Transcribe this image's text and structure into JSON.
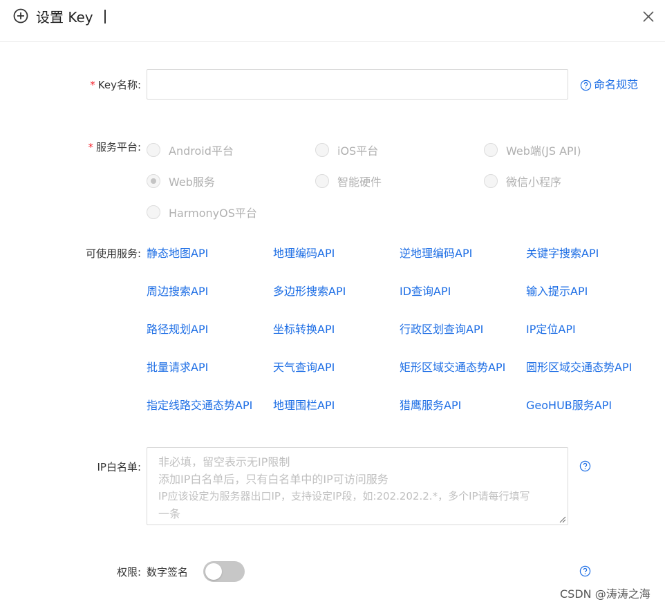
{
  "dialog": {
    "title": "设置 Key"
  },
  "form": {
    "key_name": {
      "required_mark": "*",
      "label": "Key名称:",
      "value": "",
      "help": "命名规范"
    },
    "platform": {
      "required_mark": "*",
      "label": "服务平台:",
      "options": [
        "Android平台",
        "iOS平台",
        "Web端(JS API)",
        "Web服务",
        "智能硬件",
        "微信小程序",
        "HarmonyOS平台"
      ],
      "selected": "Web服务"
    },
    "services": {
      "label": "可使用服务:",
      "items": [
        "静态地图API",
        "地理编码API",
        "逆地理编码API",
        "关键字搜索API",
        "周边搜索API",
        "多边形搜索API",
        "ID查询API",
        "输入提示API",
        "路径规划API",
        "坐标转换API",
        "行政区划查询API",
        "IP定位API",
        "批量请求API",
        "天气查询API",
        "矩形区域交通态势API",
        "圆形区域交通态势API",
        "指定线路交通态势API",
        "地理围栏API",
        "猎鹰服务API",
        "GeoHUB服务API"
      ]
    },
    "ip_whitelist": {
      "label": "IP白名单:",
      "placeholder_lines": [
        "非必填，留空表示无IP限制",
        "添加IP白名单后，只有白名单中的IP可访问服务",
        "IP应该设定为服务器出口IP，支持设定IP段，如:202.202.2.*，多个IP请每行填写",
        "一条"
      ]
    },
    "permission": {
      "label": "权限:",
      "option": "数字签名",
      "enabled": false
    }
  },
  "watermark": "CSDN @涛涛之海",
  "colors": {
    "link": "#1f6fe5",
    "required": "#f5222d",
    "toggle_off": "#c7c7c7"
  }
}
